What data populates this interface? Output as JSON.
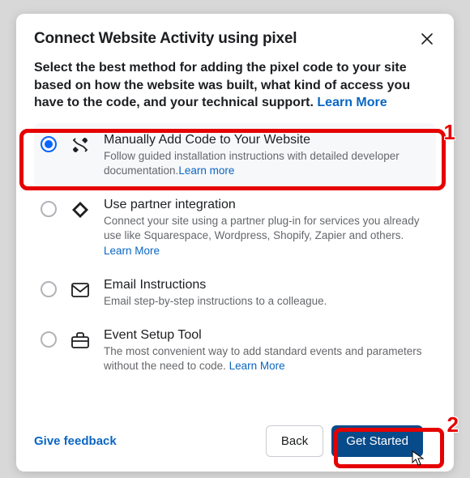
{
  "modal": {
    "title": "Connect Website Activity using pixel",
    "description": "Select the best method for adding the pixel code to your site based on how the website was built, what kind of access you have to the code, and your technical support. ",
    "descLink": "Learn More"
  },
  "options": [
    {
      "title": "Manually Add Code to Your Website",
      "desc": "Follow guided installation instructions with detailed developer documentation.",
      "link": "Learn more",
      "selected": true,
      "icon": "tools-icon"
    },
    {
      "title": "Use partner integration",
      "desc": "Connect your site using a partner plug-in for services you already use like Squarespace, Wordpress, Shopify, Zapier and others. ",
      "link": "Learn More",
      "selected": false,
      "icon": "partner-icon"
    },
    {
      "title": "Email Instructions",
      "desc": "Email step-by-step instructions to a colleague.",
      "link": "",
      "selected": false,
      "icon": "email-icon"
    },
    {
      "title": "Event Setup Tool",
      "desc": "The most convenient way to add standard events and parameters without the need to code. ",
      "link": "Learn More",
      "selected": false,
      "icon": "toolbox-icon"
    }
  ],
  "footer": {
    "feedback": "Give feedback",
    "back": "Back",
    "primary": "Get Started"
  },
  "annotations": {
    "one": "1",
    "two": "2"
  }
}
